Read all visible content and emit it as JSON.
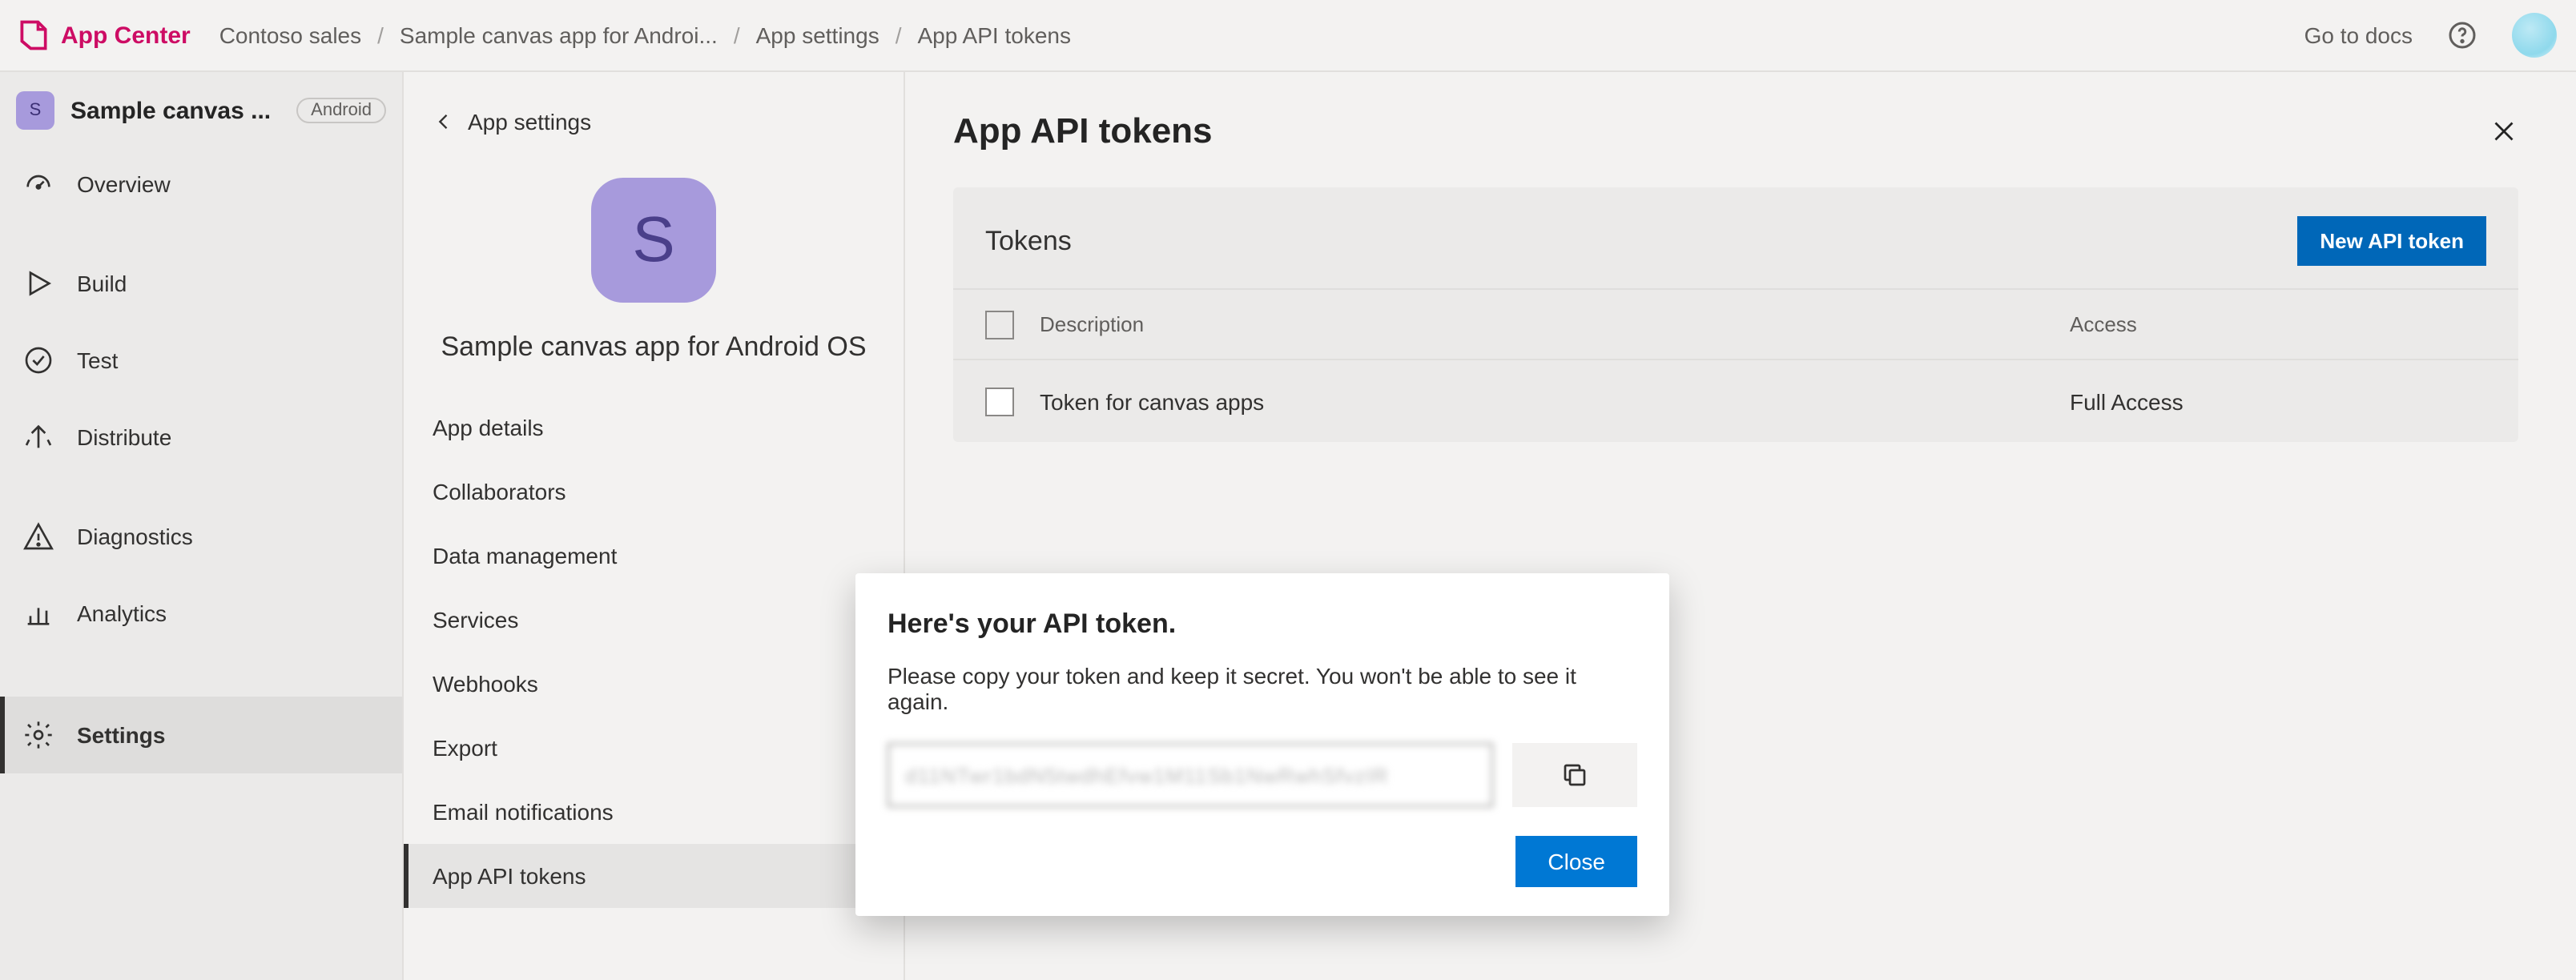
{
  "header": {
    "brand": "App Center",
    "breadcrumbs": [
      "Contoso sales",
      "Sample canvas app for Androi...",
      "App settings",
      "App API tokens"
    ],
    "go_to_docs": "Go to docs"
  },
  "sidebar": {
    "app_name_trunc": "Sample canvas ...",
    "app_initial": "S",
    "platform": "Android",
    "items": [
      {
        "label": "Overview",
        "icon": "gauge"
      },
      {
        "label": "Build",
        "icon": "play"
      },
      {
        "label": "Test",
        "icon": "check-circle"
      },
      {
        "label": "Distribute",
        "icon": "distribute"
      },
      {
        "label": "Diagnostics",
        "icon": "warning"
      },
      {
        "label": "Analytics",
        "icon": "bars"
      },
      {
        "label": "Settings",
        "icon": "gear"
      }
    ],
    "selected": "Settings"
  },
  "settings": {
    "back_label": "App settings",
    "app_initial": "S",
    "app_name": "Sample canvas app for Android OS",
    "items": [
      "App details",
      "Collaborators",
      "Data management",
      "Services",
      "Webhooks",
      "Export",
      "Email notifications",
      "App API tokens"
    ],
    "selected": "App API tokens"
  },
  "content": {
    "title": "App API tokens",
    "tokens_title": "Tokens",
    "new_token_btn": "New API token",
    "columns": {
      "description": "Description",
      "access": "Access"
    },
    "rows": [
      {
        "description": "Token for canvas apps",
        "access": "Full Access"
      }
    ]
  },
  "modal": {
    "title": "Here's your API token.",
    "body": "Please copy your token and keep it secret. You won't be able to see it again.",
    "token_preview": "d11NTwr1bdN5twdhEfvw1M11Sb1NwRwhSfvzIR",
    "close": "Close"
  }
}
